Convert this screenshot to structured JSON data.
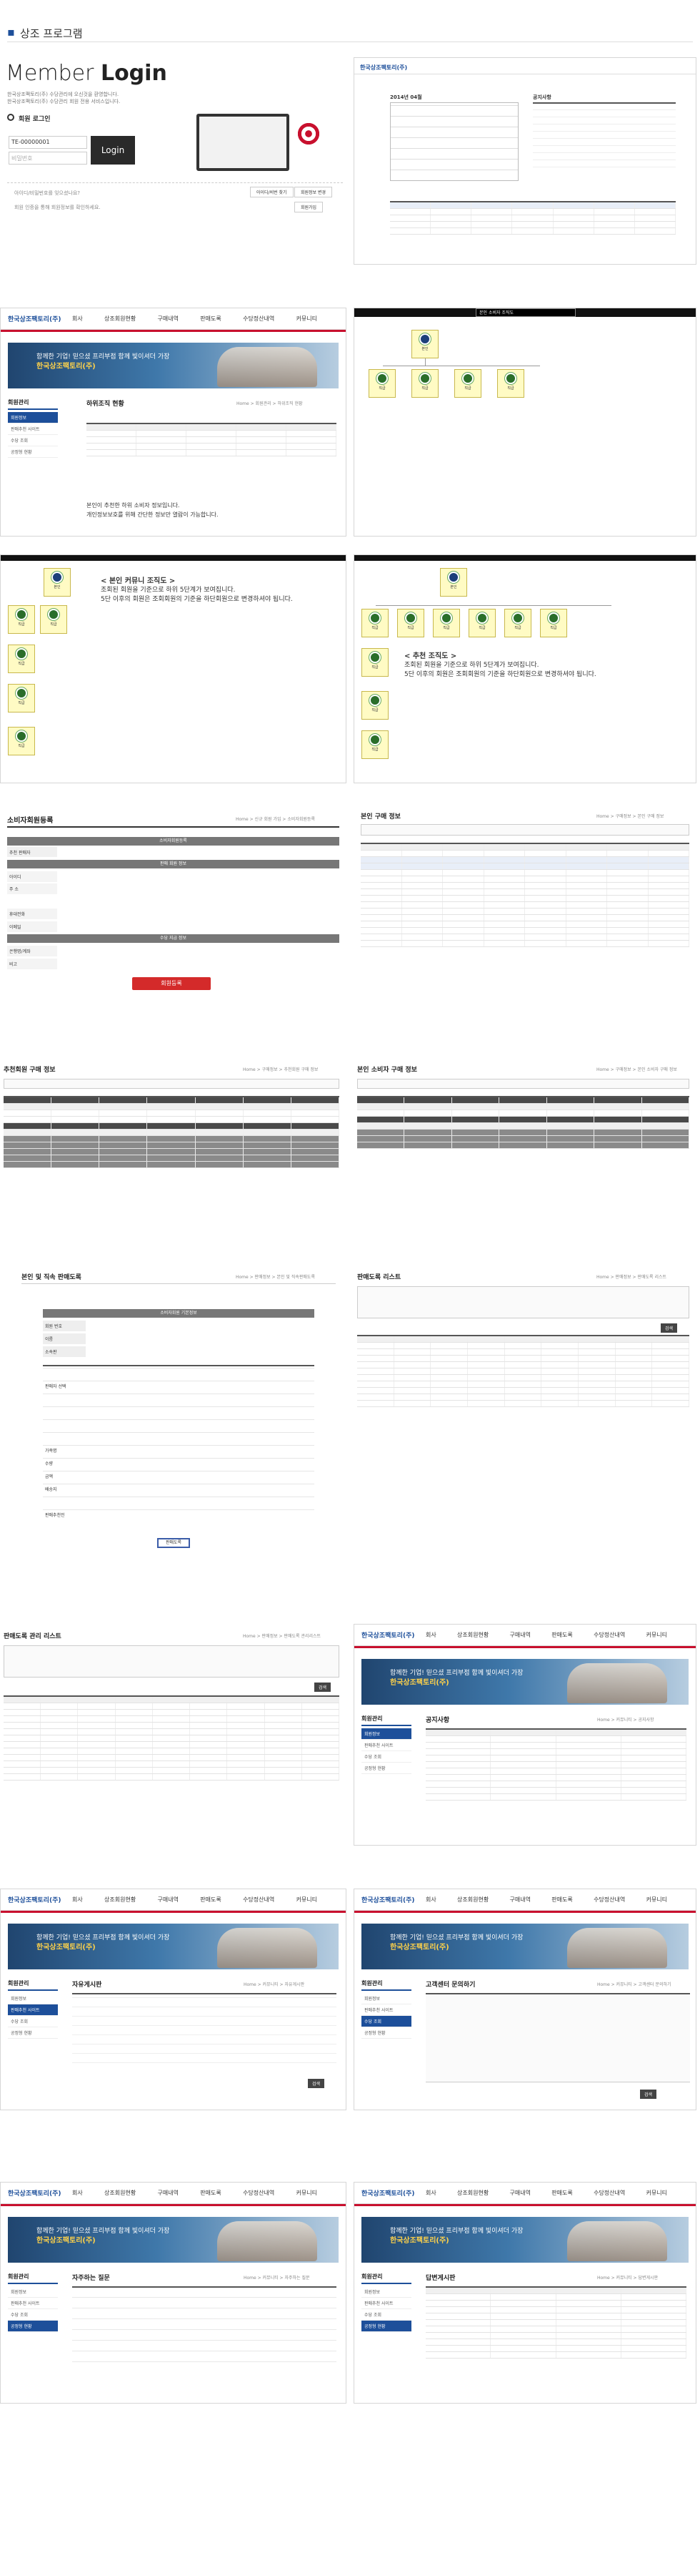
{
  "brand": {
    "company": "한국상조팩토리(주)",
    "accent": "#c8102e",
    "navy": "#1d4f9a"
  },
  "nav": [
    "회사",
    "상조회원현황",
    "구매내역",
    "판매도록",
    "수당정산내역",
    "커뮤니티"
  ],
  "header_title": "상조 프로그램",
  "login": {
    "title_light": "Member",
    "title_bold": "Login",
    "desc1": "한국상조팩토리(주) 수당관리에 오신것을 환영합니다.",
    "desc2": "한국상조팩토리(주) 수당관리 회원 전용 서비스입니다.",
    "radio_label": "회원 로그인",
    "id_value": "TE-00000001",
    "pw_placeholder": "비밀번호",
    "login_btn": "Login",
    "find1": "아이디/비밀번호를 잊으셨나요?",
    "find2": "회원 인증을 통해 회원정보를 확인하세요.",
    "btn_find": "아이디/비번 찾기",
    "btn_join": "회원정보 변경",
    "btn_reg": "회원가입"
  },
  "dashboard": {
    "logo": "한국상조팩토리(주)",
    "month": "2014년 04월",
    "board": "공지사항"
  },
  "banner": {
    "line1": "함께한 기업! 믿으셨 프리부점 함께 빛이셔더 가장",
    "line2": "한국상조팩토리(주)"
  },
  "side": {
    "title": "회원관리",
    "items": [
      "회원정보",
      "판매추천 사이트",
      "수당 조회",
      "공정형 현황"
    ]
  },
  "s3": {
    "title": "하위조직 현황",
    "crumb": "Home > 회원관리 > 하위조직 현황",
    "msg1": "본인이 추천한 하위 소비자 정보입니다.",
    "msg2": "개인정보보호를 위해 간단한 정보만 열람이 가능합니다."
  },
  "org": {
    "top": "본인",
    "unit": "직급",
    "header_input": "본인 소비자 조직도"
  },
  "org_note1": {
    "title": "< 본인 커뮤니 조직도 >",
    "l1": "조회된 회원을 기준으로 하위 5단계가 보여집니다.",
    "l2": "5단 이후의 회원은 조회회원의 기준을 하단회원으로 변경하셔야 됩니다."
  },
  "org_note2": {
    "title": "< 추천 조직도 >",
    "l1": "조회된 회원을 기준으로 하위 5단계가 보여집니다.",
    "l2": "5단 이후의 회원은 조회회원의 기준을 하단회원으로 변경하셔야 됩니다."
  },
  "reg": {
    "title": "소비자회원등록",
    "crumb": "Home > 신규 회원 가입 > 소비자회원등록",
    "sec1": "소비자회원등록",
    "sec2": "판매 회원 정보",
    "sec3": "수당 지급 정보",
    "btn": "회원등록",
    "fields": [
      "추천 판매자",
      "아이디",
      "주 소",
      "휴대전화",
      "이메일",
      "은행명/계좌",
      "비고"
    ]
  },
  "p6": {
    "title": "본인 구매 정보",
    "crumb": "Home > 구매정보 > 본인 구매 정보"
  },
  "p7": {
    "title": "추천회원 구매 정보",
    "crumb": "Home > 구매정보 > 추천회원 구매 정보"
  },
  "p8": {
    "title": "본인 소비자 구매 정보",
    "crumb": "Home > 구매정보 > 본인 소비자 구매 정보"
  },
  "p9": {
    "title": "본인 및 직속 판매도록",
    "crumb": "Home > 판매정보 > 본인 및 직속판매도록",
    "sec": "소비자회원 기본정보",
    "btn": "판매도록",
    "fields": [
      "회원 번호",
      "이름",
      "소속판",
      "판매자 선택",
      "가족명",
      "수량",
      "금액",
      "배송지",
      "판매추천인"
    ]
  },
  "p10": {
    "title": "판매도록 리스트",
    "crumb": "Home > 판매정보 > 판매도록 리스트"
  },
  "p11": {
    "title": "판매도록 관리 리스트",
    "crumb": "Home > 판매정보 > 판매도록 관리리스트"
  },
  "p12": {
    "title": "공지사항",
    "crumb": "Home > 커뮤니티 > 공지사항"
  },
  "p13": {
    "title": "자유게시판",
    "crumb": "Home > 커뮤니티 > 자유게시판"
  },
  "p14": {
    "title": "고객센터 문의하기",
    "crumb": "Home > 커뮤니티 > 고객센터 문의하기"
  },
  "p15": {
    "title": "자주하는 질문",
    "crumb": "Home > 커뮤니티 > 자주하는 질문"
  },
  "p16": {
    "title": "답변게시판",
    "crumb": "Home > 커뮤니티 > 답변게시판"
  },
  "search_btn": "검색"
}
